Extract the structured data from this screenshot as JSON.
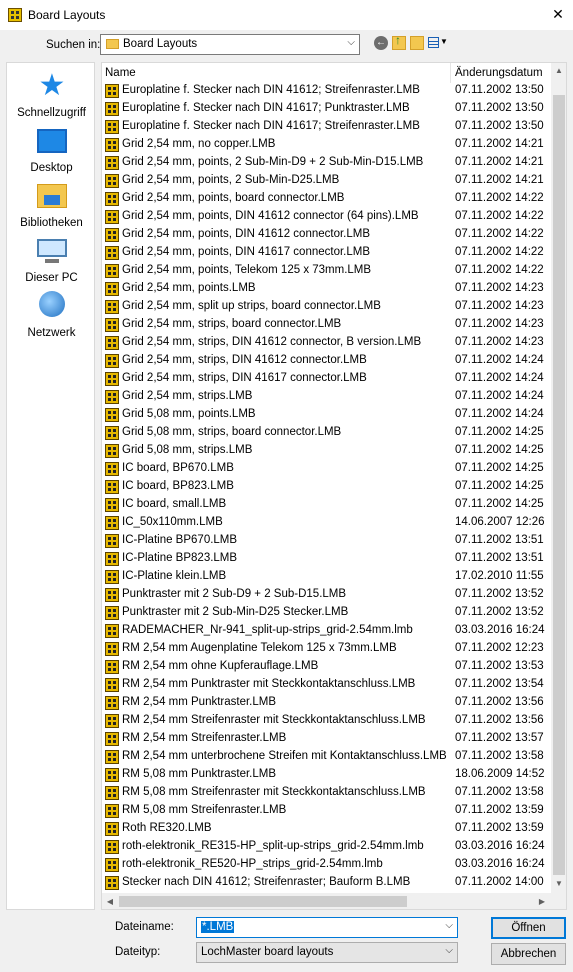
{
  "window": {
    "title": "Board Layouts",
    "close_glyph": "✕"
  },
  "lookin": {
    "label": "Suchen in:",
    "value": "Board Layouts"
  },
  "places": [
    {
      "label": "Schnellzugriff",
      "icon": "star-icon"
    },
    {
      "label": "Desktop",
      "icon": "desktop-icon"
    },
    {
      "label": "Bibliotheken",
      "icon": "libraries-icon"
    },
    {
      "label": "Dieser PC",
      "icon": "computer-icon"
    },
    {
      "label": "Netzwerk",
      "icon": "network-icon"
    }
  ],
  "columns": {
    "name": "Name",
    "date": "Änderungsdatum"
  },
  "files": [
    {
      "name": "Europlatine f. Stecker nach DIN 41612; Streifenraster.LMB",
      "date": "07.11.2002 13:50"
    },
    {
      "name": "Europlatine f. Stecker nach DIN 41617; Punktraster.LMB",
      "date": "07.11.2002 13:50"
    },
    {
      "name": "Europlatine f. Stecker nach DIN 41617; Streifenraster.LMB",
      "date": "07.11.2002 13:50"
    },
    {
      "name": "Grid 2,54 mm, no copper.LMB",
      "date": "07.11.2002 14:21"
    },
    {
      "name": "Grid 2,54 mm, points, 2 Sub-Min-D9 + 2 Sub-Min-D15.LMB",
      "date": "07.11.2002 14:21"
    },
    {
      "name": "Grid 2,54 mm, points, 2 Sub-Min-D25.LMB",
      "date": "07.11.2002 14:21"
    },
    {
      "name": "Grid 2,54 mm, points, board connector.LMB",
      "date": "07.11.2002 14:22"
    },
    {
      "name": "Grid 2,54 mm, points, DIN 41612 connector (64 pins).LMB",
      "date": "07.11.2002 14:22"
    },
    {
      "name": "Grid 2,54 mm, points, DIN 41612 connector.LMB",
      "date": "07.11.2002 14:22"
    },
    {
      "name": "Grid 2,54 mm, points, DIN 41617 connector.LMB",
      "date": "07.11.2002 14:22"
    },
    {
      "name": "Grid 2,54 mm, points, Telekom 125 x 73mm.LMB",
      "date": "07.11.2002 14:22"
    },
    {
      "name": "Grid 2,54 mm, points.LMB",
      "date": "07.11.2002 14:23"
    },
    {
      "name": "Grid 2,54 mm, split up strips, board connector.LMB",
      "date": "07.11.2002 14:23"
    },
    {
      "name": "Grid 2,54 mm, strips, board connector.LMB",
      "date": "07.11.2002 14:23"
    },
    {
      "name": "Grid 2,54 mm, strips, DIN 41612 connector, B version.LMB",
      "date": "07.11.2002 14:23"
    },
    {
      "name": "Grid 2,54 mm, strips, DIN 41612 connector.LMB",
      "date": "07.11.2002 14:24"
    },
    {
      "name": "Grid 2,54 mm, strips, DIN 41617 connector.LMB",
      "date": "07.11.2002 14:24"
    },
    {
      "name": "Grid 2,54 mm, strips.LMB",
      "date": "07.11.2002 14:24"
    },
    {
      "name": "Grid 5,08 mm, points.LMB",
      "date": "07.11.2002 14:24"
    },
    {
      "name": "Grid 5,08 mm, strips, board connector.LMB",
      "date": "07.11.2002 14:25"
    },
    {
      "name": "Grid 5,08 mm, strips.LMB",
      "date": "07.11.2002 14:25"
    },
    {
      "name": "IC board, BP670.LMB",
      "date": "07.11.2002 14:25"
    },
    {
      "name": "IC board, BP823.LMB",
      "date": "07.11.2002 14:25"
    },
    {
      "name": "IC board, small.LMB",
      "date": "07.11.2002 14:25"
    },
    {
      "name": "IC_50x110mm.LMB",
      "date": "14.06.2007 12:26"
    },
    {
      "name": "IC-Platine BP670.LMB",
      "date": "07.11.2002 13:51"
    },
    {
      "name": "IC-Platine BP823.LMB",
      "date": "07.11.2002 13:51"
    },
    {
      "name": "IC-Platine klein.LMB",
      "date": "17.02.2010 11:55"
    },
    {
      "name": "Punktraster mit 2 Sub-D9 + 2 Sub-D15.LMB",
      "date": "07.11.2002 13:52"
    },
    {
      "name": "Punktraster mit 2 Sub-Min-D25 Stecker.LMB",
      "date": "07.11.2002 13:52"
    },
    {
      "name": "RADEMACHER_Nr-941_split-up-strips_grid-2.54mm.lmb",
      "date": "03.03.2016 16:24"
    },
    {
      "name": "RM 2,54 mm Augenplatine Telekom 125 x 73mm.LMB",
      "date": "07.11.2002 12:23"
    },
    {
      "name": "RM 2,54 mm ohne Kupferauflage.LMB",
      "date": "07.11.2002 13:53"
    },
    {
      "name": "RM 2,54 mm Punktraster mit Steckkontaktanschluss.LMB",
      "date": "07.11.2002 13:54"
    },
    {
      "name": "RM 2,54 mm Punktraster.LMB",
      "date": "07.11.2002 13:56"
    },
    {
      "name": "RM 2,54 mm Streifenraster mit Steckkontaktanschluss.LMB",
      "date": "07.11.2002 13:56"
    },
    {
      "name": "RM 2,54 mm Streifenraster.LMB",
      "date": "07.11.2002 13:57"
    },
    {
      "name": "RM 2,54 mm unterbrochene Streifen mit Kontaktanschluss.LMB",
      "date": "07.11.2002 13:58"
    },
    {
      "name": "RM 5,08 mm Punktraster.LMB",
      "date": "18.06.2009 14:52"
    },
    {
      "name": "RM 5,08 mm Streifenraster mit Steckkontaktanschluss.LMB",
      "date": "07.11.2002 13:58"
    },
    {
      "name": "RM 5,08 mm Streifenraster.LMB",
      "date": "07.11.2002 13:59"
    },
    {
      "name": "Roth RE320.LMB",
      "date": "07.11.2002 13:59"
    },
    {
      "name": "roth-elektronik_RE315-HP_split-up-strips_grid-2.54mm.lmb",
      "date": "03.03.2016 16:24"
    },
    {
      "name": "roth-elektronik_RE520-HP_strips_grid-2.54mm.lmb",
      "date": "03.03.2016 16:24"
    },
    {
      "name": "Stecker nach DIN 41612; Streifenraster; Bauform B.LMB",
      "date": "07.11.2002 14:00"
    }
  ],
  "filename": {
    "label": "Dateiname:",
    "value": "*.LMB"
  },
  "filetype": {
    "label": "Dateityp:",
    "value": "LochMaster board layouts"
  },
  "buttons": {
    "open": "Öffnen",
    "cancel": "Abbrechen"
  }
}
